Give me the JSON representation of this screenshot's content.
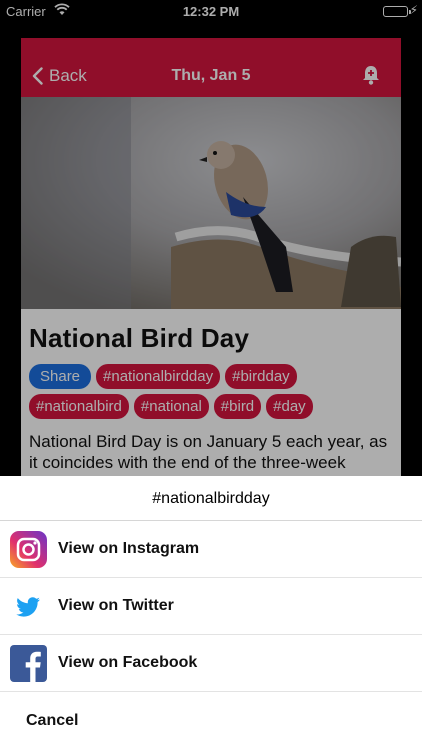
{
  "status_bar": {
    "carrier": "Carrier",
    "time": "12:32 PM",
    "battery_level": 1.0
  },
  "nav": {
    "back_label": "Back",
    "title": "Thu, Jan 5",
    "bell_icon": "bell-plus-icon"
  },
  "event": {
    "title": "National Bird Day",
    "tags": [
      "Share",
      "#nationalbirdday",
      "#birdday",
      "#nationalbird",
      "#national",
      "#bird",
      "#day"
    ],
    "description": "National Bird Day is on January 5 each year, as it coincides with the end of the three-week"
  },
  "sheet": {
    "title": "#nationalbirdday",
    "options": [
      {
        "label": "View on Instagram",
        "icon": "instagram-icon"
      },
      {
        "label": "View on Twitter",
        "icon": "twitter-icon"
      },
      {
        "label": "View on Facebook",
        "icon": "facebook-icon"
      }
    ],
    "cancel_label": "Cancel"
  },
  "colors": {
    "brand_red": "#d5153f",
    "share_blue": "#1c6fe0"
  }
}
